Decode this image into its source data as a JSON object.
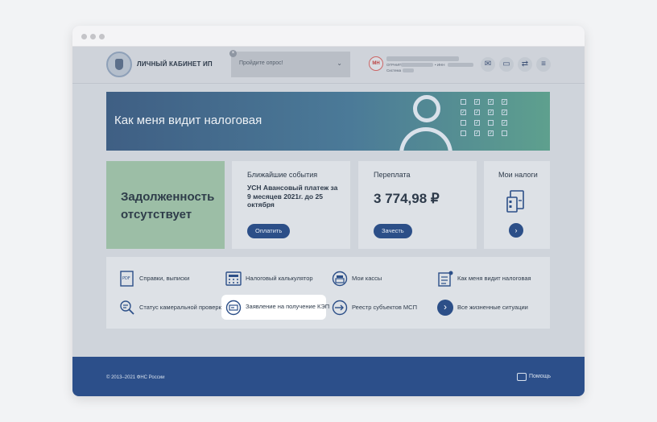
{
  "header": {
    "brand": "ЛИЧНЫЙ КАБИНЕТ ИП",
    "survey_placeholder": "Пройдите опрос!",
    "survey_close": "×",
    "avatar_initials": "МН",
    "user_ogrnip_label": "ОГРНИП",
    "user_inn_label": "• ИНН",
    "user_system_label": "Система"
  },
  "banner": {
    "title": "Как меня видит налоговая"
  },
  "cards": {
    "debt": {
      "line1": "Задолженность",
      "line2": "отсутствует"
    },
    "events": {
      "title": "Ближайшие события",
      "body": "УСН Авансовый платеж за 9 месяцев 2021г. до 25 октября",
      "button": "Оплатить"
    },
    "overpay": {
      "title": "Переплата",
      "amount": "3 774,98 ₽",
      "button": "Зачесть"
    },
    "taxes": {
      "title": "Мои налоги",
      "arrow": "›"
    }
  },
  "services": [
    {
      "label": "Справки, выписки",
      "icon": "pdf-document-icon"
    },
    {
      "label": "Налоговый калькулятор",
      "icon": "calculator-icon"
    },
    {
      "label": "Мои кассы",
      "icon": "cash-register-icon"
    },
    {
      "label": "Как меня видит налоговая",
      "icon": "checklist-icon"
    },
    {
      "label": "Статус камеральной проверки",
      "icon": "magnifier-doc-icon"
    },
    {
      "label": "Заявление на получение КЭП",
      "icon": "signature-card-icon"
    },
    {
      "label": "Реестр субъектов МСП",
      "icon": "registry-icon"
    },
    {
      "label": "Все жизненные ситуации",
      "icon": "chevron-right-icon",
      "glyph": "›"
    }
  ],
  "footer": {
    "copyright": "© 2013–2021 ФНС России",
    "help": "Помощь"
  },
  "colors": {
    "accent": "#2c4f88",
    "debt_card": "#9cbea6",
    "highlight": "#ffffff"
  }
}
